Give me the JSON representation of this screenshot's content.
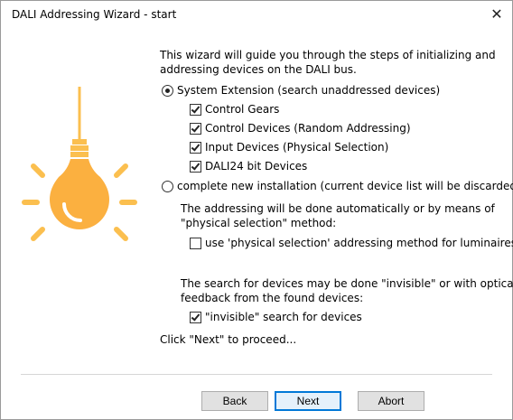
{
  "window": {
    "title": "DALI Addressing Wizard - start",
    "close_glyph": "✕"
  },
  "intro": {
    "line1": "This wizard will guide you through the steps of initializing and",
    "line2": "addressing devices on the DALI bus."
  },
  "options": {
    "system_extension": {
      "label": "System Extension (search unaddressed devices)",
      "selected": true,
      "sub": [
        {
          "label": "Control Gears",
          "checked": true
        },
        {
          "label": "Control Devices (Random Addressing)",
          "checked": true
        },
        {
          "label": "Input Devices (Physical Selection)",
          "checked": true
        },
        {
          "label": "DALI24 bit Devices",
          "checked": true
        }
      ]
    },
    "new_installation": {
      "label": "complete new installation (current device list will be discarded)",
      "selected": false,
      "info_line1": "The addressing will be done automatically or by means of",
      "info_line2": "\"physical selection\" method:",
      "physical_selection": {
        "label": "use 'physical selection' addressing method for luminaires",
        "checked": false
      }
    }
  },
  "search": {
    "info_line1": "The search for devices may be done \"invisible\" or with optical",
    "info_line2": "feedback from the found devices:",
    "invisible": {
      "label": "\"invisible\" search for devices",
      "checked": true
    }
  },
  "footer_text": "Click \"Next\" to proceed...",
  "buttons": {
    "back": "Back",
    "next": "Next",
    "abort": "Abort"
  },
  "colors": {
    "bulb": "#fbb040",
    "bulb_glow": "#ffd98a",
    "rays": "#fbbf4f",
    "default_button_border": "#0078d7"
  },
  "icons": {
    "bulb": "light-bulb-icon",
    "close": "close-icon"
  }
}
